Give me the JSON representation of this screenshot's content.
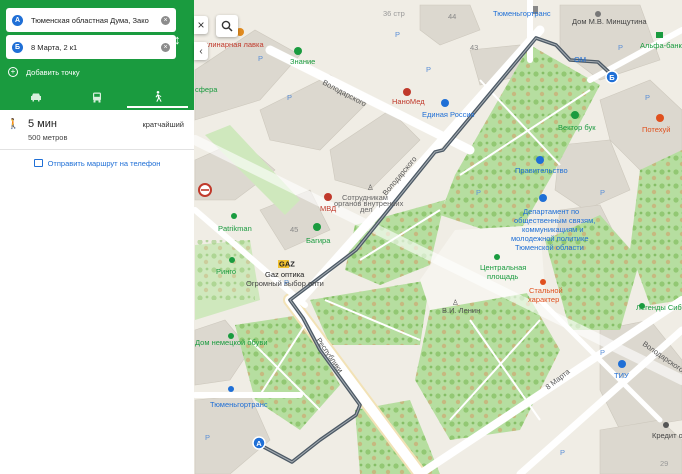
{
  "route": {
    "from": {
      "marker": "А",
      "value": "Тюменская областная Дума, Зако"
    },
    "to": {
      "marker": "Б",
      "value": "8 Марта, 2 к1"
    },
    "add_point_label": "Добавить точку",
    "modes": [
      {
        "icon": "car-icon",
        "active": false
      },
      {
        "icon": "bus-icon",
        "active": false
      },
      {
        "icon": "walk-icon",
        "active": true
      }
    ]
  },
  "summary": {
    "duration": "5 мин",
    "distance": "500 метров",
    "tag": "кратчайший"
  },
  "send_to_phone_label": "Отправить маршрут на телефон",
  "colors": {
    "panel_green": "#1a9b3f",
    "route_line": "#4d5a66",
    "marker_blue": "#1f6fd6",
    "park_green": "#b6dea0"
  },
  "map": {
    "street_labels": {
      "volodarskogo_top": "Володарского",
      "volodarskogo_mid": "Володарского",
      "respubliki": "Республики",
      "vosmogo_marta": "8 Марта",
      "volodarskogo_right": "Володарского"
    },
    "numbers": {
      "n44": "44",
      "n43": "43",
      "n45": "45",
      "n36": "36 стр",
      "n29": "29"
    },
    "pois": {
      "tyumentransgortrans_top": "Тюменьгортранс",
      "dom_mincutina": "Дом М.В. Минщутина",
      "alfa_bank": "Альфа-банк",
      "kulinarnaya_lavka": "Кулинарная лавка",
      "znanie": "Знание",
      "sfera": "сфера",
      "nanomed": "НаноМед",
      "edinaya_rossiya": "Единая Россия",
      "vektor_buk": "Вектор бук",
      "potekhuy": "Потехуй",
      "pravitelstvo": "Правительство",
      "sotrudnikam_line1": "Сотрудникам",
      "sotrudnikam_line2": "органов внутренних",
      "sotrudnikam_line3": "дел",
      "mvd": "МВД",
      "dept_line1": "Департамент по",
      "dept_line2": "общественным связям,",
      "dept_line3": "коммуникациям и",
      "dept_line4": "молодежной политике",
      "dept_line5": "Тюменской области",
      "patrikman": "Patrikman",
      "bagira": "Багира",
      "gaz_logo": "GAZ",
      "gaz_optika": "Gaz оптика",
      "gaz_optika_sub": "Огромный выбор опти",
      "ringo": "Ринго",
      "central_square_line1": "Центральная",
      "central_square_line2": "площадь",
      "stalnoy_line1": "Стальной",
      "stalnoy_line2": "характер",
      "lenin": "В.И. Ленин",
      "legendy_sibiri": "Легенды Сибир",
      "dom_nemeckoy_obuvi": "Дом немецкой обуви",
      "tiu": "ТИУ",
      "tyumentransgortrans_bottom": "Тюменьгортранс",
      "kredit": "Кредит от",
      "ommi": "ОМ",
      "pin_a": "А",
      "pin_b": "Б"
    }
  }
}
